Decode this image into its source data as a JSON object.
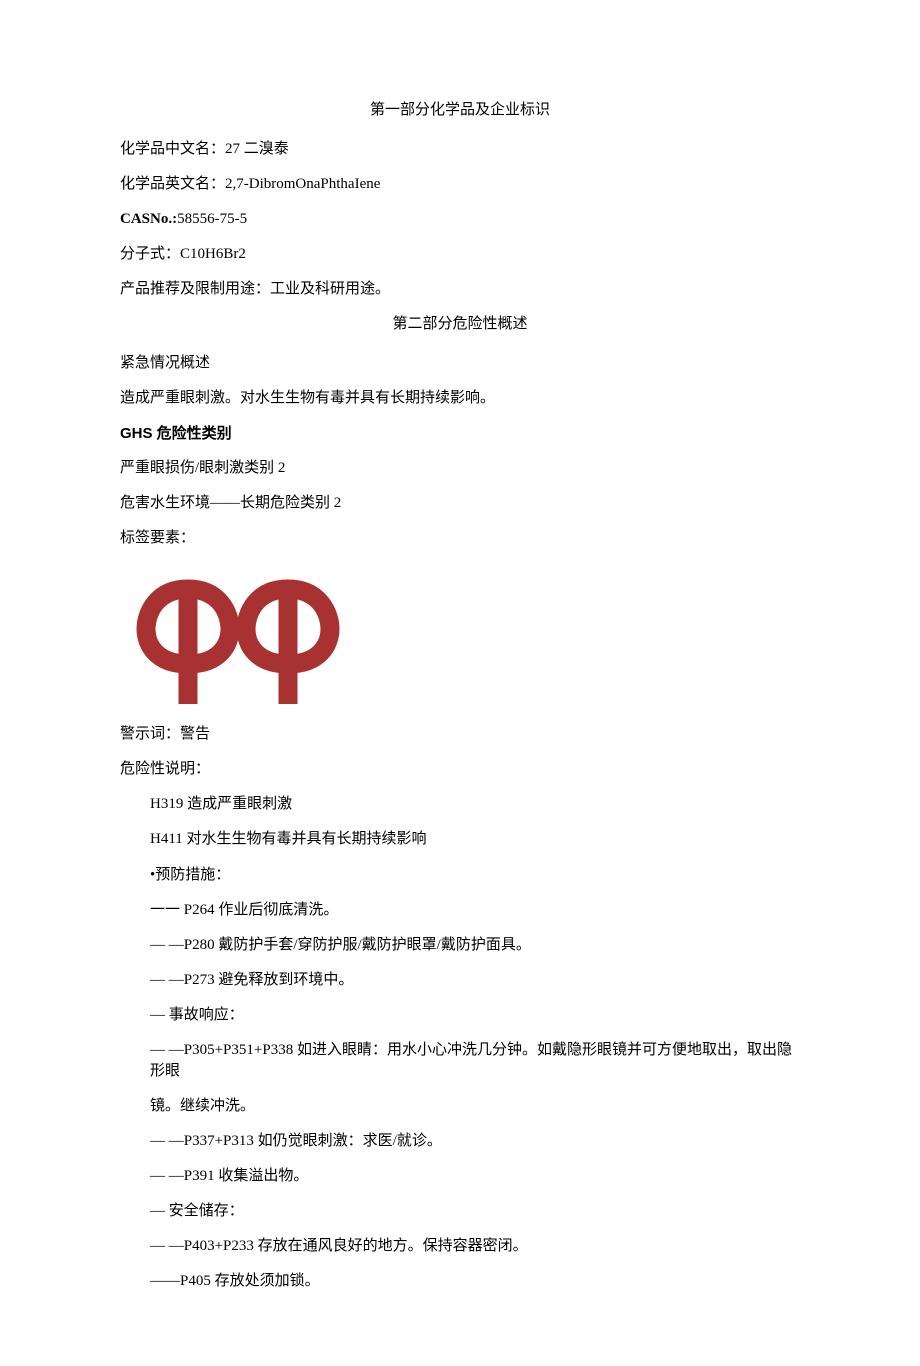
{
  "section1": {
    "title": "第一部分化学品及企业标识",
    "cn_name_label": "化学品中文名：",
    "cn_name": "27 二溴泰",
    "en_name_label": "化学品英文名：",
    "en_name": "2,7-DibromOnaPhthaIene",
    "cas_label": "CASNo.:",
    "cas": "58556-75-5",
    "formula_label": "分子式：",
    "formula": "C10H6Br2",
    "uses_label": "产品推荐及限制用途：",
    "uses": "工业及科研用途。"
  },
  "section2": {
    "title": "第二部分危险性概述",
    "emergency_label": "紧急情况概述",
    "emergency_text": "造成严重眼刺激。对水生生物有毒并具有长期持续影响。",
    "ghs_label": "GHS 危险性类别",
    "ghs_line1": "严重眼损伤/眼刺激类别 2",
    "ghs_line2": "危害水生环境——长期危险类别 2",
    "label_elements": "标签要素：",
    "signal_label": "警示词：",
    "signal_word": "警告",
    "hazard_label": "危险性说明：",
    "hazards": {
      "h319": "H319 造成严重眼刺激",
      "h411": "H411 对水生生物有毒并具有长期持续影响"
    },
    "prevention_label": "•预防措施：",
    "prevention": {
      "p264": "一一 P264 作业后彻底清洗。",
      "p280": "—   —P280 戴防护手套/穿防护服/戴防护眼罩/戴防护面具。",
      "p273": "—   —P273 避免释放到环境中。"
    },
    "response_label": "— 事故响应：",
    "response": {
      "p305_1": "—   —P305+P351+P338 如进入眼睛：用水小心冲洗几分钟。如戴隐形眼镜并可方便地取出，取出隐形眼",
      "p305_2": "镜。继续冲洗。",
      "p337": "—   —P337+P313 如仍觉眼刺激：求医/就诊。",
      "p391": "—   —P391 收集溢出物。"
    },
    "storage_label": "— 安全储存：",
    "storage": {
      "p403": "—   —P403+P233 存放在通风良好的地方。保持容器密闭。",
      "p405": "——P405 存放处须加锁。"
    }
  }
}
